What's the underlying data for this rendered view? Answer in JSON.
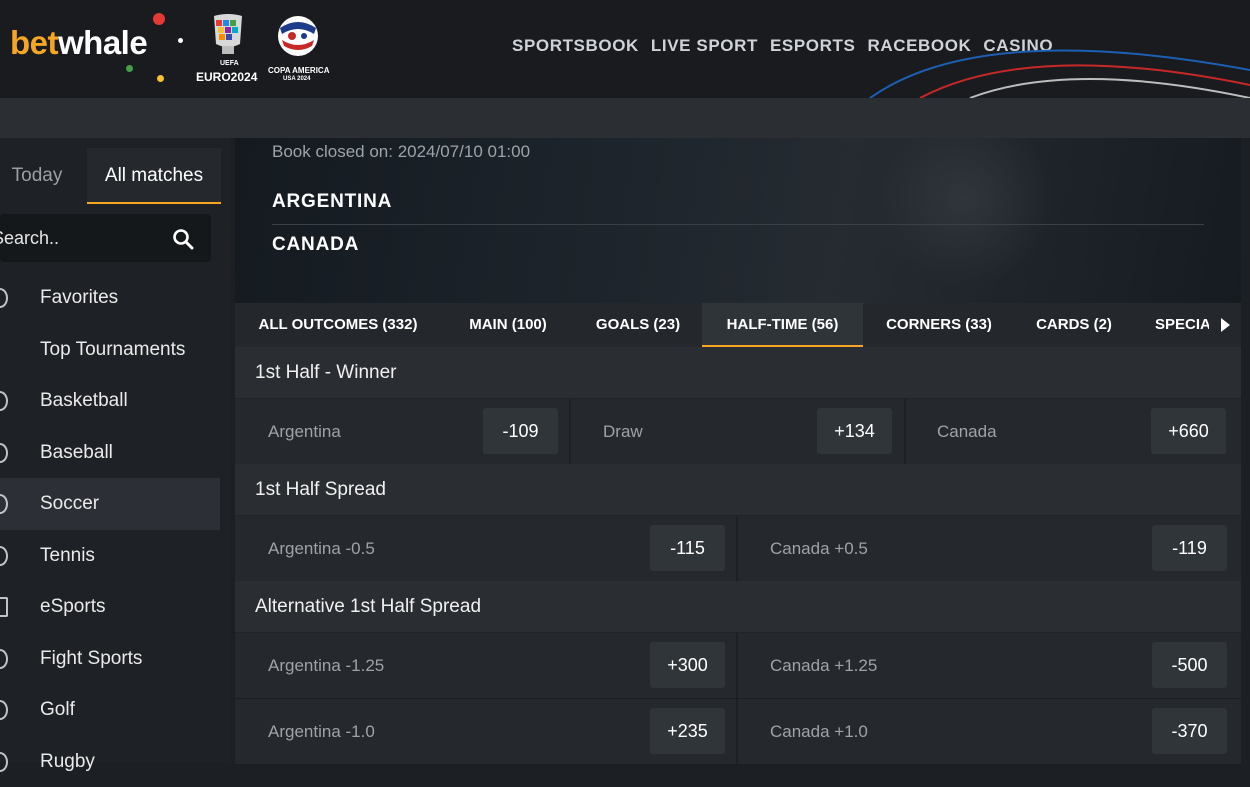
{
  "header": {
    "logo_bet": "bet",
    "logo_whale": "whale",
    "euro_caption": "EURO2024",
    "euro_small": "UEFA",
    "copa_caption": "COPA AMERICA",
    "copa_small": "USA 2024",
    "nav": [
      "SPORTSBOOK",
      "LIVE SPORT",
      "ESPORTS",
      "RACEBOOK",
      "CASINO"
    ]
  },
  "sidebar": {
    "tab_today": "Today",
    "tab_all": "All matches",
    "search_placeholder": "Search..",
    "items": [
      {
        "label": "Favorites",
        "icon": "heart-icon"
      },
      {
        "label": "Top Tournaments",
        "icon": "trophy-icon"
      },
      {
        "label": "Basketball",
        "icon": "basketball-icon"
      },
      {
        "label": "Baseball",
        "icon": "baseball-icon"
      },
      {
        "label": "Soccer",
        "icon": "soccer-ball-icon",
        "active": true
      },
      {
        "label": "Tennis",
        "icon": "tennis-ball-icon"
      },
      {
        "label": "eSports",
        "icon": "gamepad-icon"
      },
      {
        "label": "Fight Sports",
        "icon": "glove-icon"
      },
      {
        "label": "Golf",
        "icon": "golf-icon"
      },
      {
        "label": "Rugby",
        "icon": "rugby-icon"
      }
    ]
  },
  "event": {
    "book_closed": "Book closed on: 2024/07/10 01:00",
    "team1": "ARGENTINA",
    "team2": "CANADA"
  },
  "market_tabs": [
    {
      "label": "ALL OUTCOMES (332)"
    },
    {
      "label": "MAIN (100)"
    },
    {
      "label": "GOALS (23)"
    },
    {
      "label": "HALF-TIME (56)",
      "active": true
    },
    {
      "label": "CORNERS (33)"
    },
    {
      "label": "CARDS (2)"
    },
    {
      "label": "SPECIA"
    }
  ],
  "markets": [
    {
      "title": "1st Half - Winner",
      "rows": [
        [
          {
            "label": "Argentina",
            "odd": "-109"
          },
          {
            "label": "Draw",
            "odd": "+134"
          },
          {
            "label": "Canada",
            "odd": "+660"
          }
        ]
      ]
    },
    {
      "title": "1st Half Spread",
      "rows": [
        [
          {
            "label": "Argentina -0.5",
            "odd": "-115"
          },
          {
            "label": "Canada +0.5",
            "odd": "-119"
          }
        ]
      ]
    },
    {
      "title": "Alternative 1st Half Spread",
      "rows": [
        [
          {
            "label": "Argentina -1.25",
            "odd": "+300"
          },
          {
            "label": "Canada +1.25",
            "odd": "-500"
          }
        ],
        [
          {
            "label": "Argentina -1.0",
            "odd": "+235"
          },
          {
            "label": "Canada +1.0",
            "odd": "-370"
          }
        ]
      ]
    }
  ],
  "colors": {
    "accent": "#f5a623",
    "background": "#1c1f23",
    "header": "#191b1f"
  }
}
